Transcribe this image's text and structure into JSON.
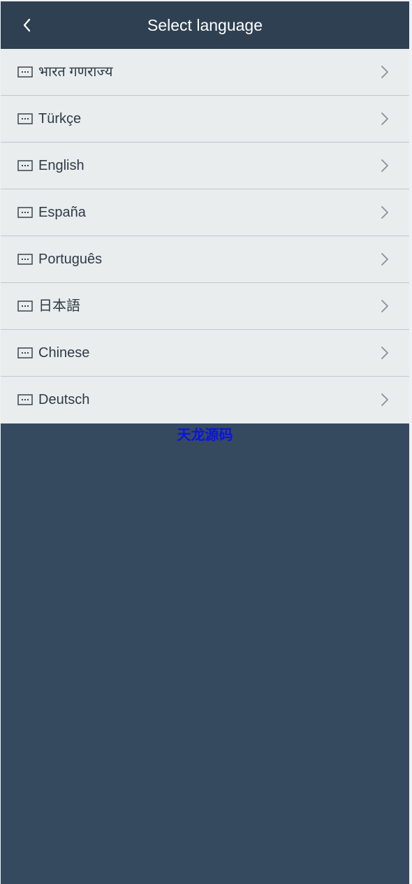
{
  "header": {
    "title": "Select language",
    "back_icon": "chevron-left-icon"
  },
  "languages": [
    {
      "label": "भारत गणराज्य"
    },
    {
      "label": "Türkçe"
    },
    {
      "label": "English"
    },
    {
      "label": "España"
    },
    {
      "label": "Português"
    },
    {
      "label": "日本語"
    },
    {
      "label": "Chinese"
    },
    {
      "label": "Deutsch"
    }
  ],
  "row_icons": {
    "leading": "keyboard-icon",
    "trailing": "chevron-right-icon"
  },
  "watermark": "天龙源码",
  "colors": {
    "header_bg": "#2f4052",
    "page_bg": "#364a5f",
    "list_bg": "#e9edee",
    "text": "#2f3b47",
    "chevron": "#8a9095",
    "watermark": "#0a12e6"
  }
}
